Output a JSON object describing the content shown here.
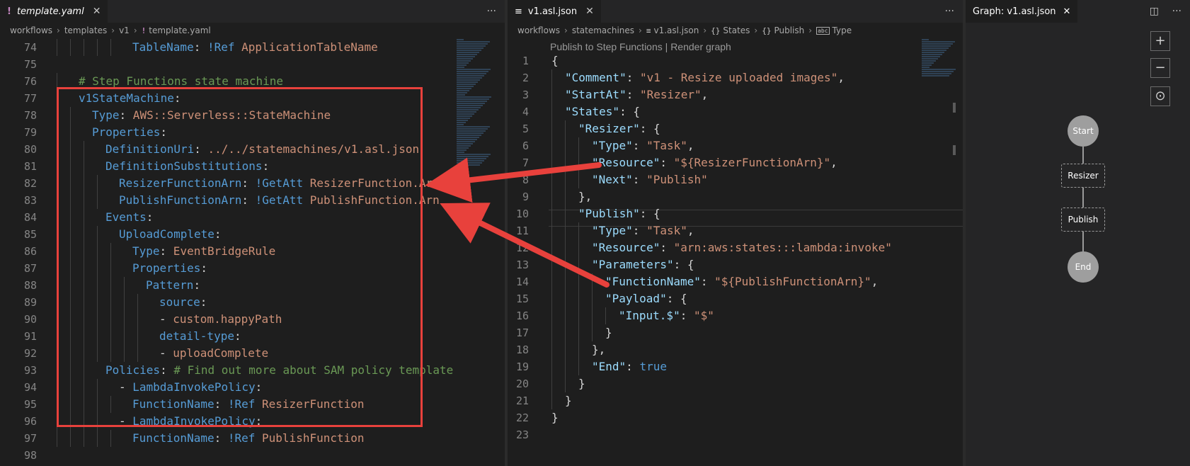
{
  "left": {
    "tab_icon": "!",
    "tab_label": "template.yaml",
    "more": "···",
    "breadcrumbs": [
      "workflows",
      "templates",
      "v1",
      "template.yaml"
    ],
    "lines": [
      {
        "n": "74",
        "t": "TableName: !Ref ApplicationTableName"
      },
      {
        "n": "75",
        "t": ""
      },
      {
        "n": "76",
        "t": "# Step Functions state machine"
      },
      {
        "n": "77",
        "t": "v1StateMachine:"
      },
      {
        "n": "78",
        "t": "Type: AWS::Serverless::StateMachine"
      },
      {
        "n": "79",
        "t": "Properties:"
      },
      {
        "n": "80",
        "t": "DefinitionUri: ../../statemachines/v1.asl.json"
      },
      {
        "n": "81",
        "t": "DefinitionSubstitutions:"
      },
      {
        "n": "82",
        "t": "ResizerFunctionArn: !GetAtt ResizerFunction.Arn"
      },
      {
        "n": "83",
        "t": "PublishFunctionArn: !GetAtt PublishFunction.Arn"
      },
      {
        "n": "84",
        "t": "Events:"
      },
      {
        "n": "85",
        "t": "UploadComplete:"
      },
      {
        "n": "86",
        "t": "Type: EventBridgeRule"
      },
      {
        "n": "87",
        "t": "Properties:"
      },
      {
        "n": "88",
        "t": "Pattern:"
      },
      {
        "n": "89",
        "t": "source:"
      },
      {
        "n": "90",
        "t": "- custom.happyPath"
      },
      {
        "n": "91",
        "t": "detail-type:"
      },
      {
        "n": "92",
        "t": "- uploadComplete"
      },
      {
        "n": "93",
        "t": "Policies: # Find out more about SAM policy template"
      },
      {
        "n": "94",
        "t": "- LambdaInvokePolicy:"
      },
      {
        "n": "95",
        "t": "FunctionName: !Ref ResizerFunction"
      },
      {
        "n": "96",
        "t": "- LambdaInvokePolicy:"
      },
      {
        "n": "97",
        "t": "FunctionName: !Ref PublishFunction"
      },
      {
        "n": "98",
        "t": ""
      }
    ]
  },
  "middle": {
    "tab_icon": "≡",
    "tab_label": "v1.asl.json",
    "more": "···",
    "breadcrumbs": [
      "workflows",
      "statemachines",
      "v1.asl.json",
      "States",
      "Publish",
      "Type"
    ],
    "codelens": {
      "publish": "Publish to Step Functions",
      "sep": " | ",
      "render": "Render graph"
    },
    "lines": [
      {
        "n": "1",
        "t": "{"
      },
      {
        "n": "2",
        "t": "\"Comment\": \"v1 - Resize uploaded images\","
      },
      {
        "n": "3",
        "t": "\"StartAt\": \"Resizer\","
      },
      {
        "n": "4",
        "t": "\"States\": {"
      },
      {
        "n": "5",
        "t": "\"Resizer\": {"
      },
      {
        "n": "6",
        "t": "\"Type\": \"Task\","
      },
      {
        "n": "7",
        "t": "\"Resource\": \"${ResizerFunctionArn}\","
      },
      {
        "n": "8",
        "t": "\"Next\": \"Publish\""
      },
      {
        "n": "9",
        "t": "},"
      },
      {
        "n": "10",
        "t": "\"Publish\": {"
      },
      {
        "n": "11",
        "t": "\"Type\": \"Task\","
      },
      {
        "n": "12",
        "t": "\"Resource\": \"arn:aws:states:::lambda:invoke\""
      },
      {
        "n": "13",
        "t": "\"Parameters\": {"
      },
      {
        "n": "14",
        "t": "\"FunctionName\": \"${PublishFunctionArn}\","
      },
      {
        "n": "15",
        "t": "\"Payload\": {"
      },
      {
        "n": "16",
        "t": "\"Input.$\": \"$\""
      },
      {
        "n": "17",
        "t": "}"
      },
      {
        "n": "18",
        "t": "},"
      },
      {
        "n": "19",
        "t": "\"End\": true"
      },
      {
        "n": "20",
        "t": "}"
      },
      {
        "n": "21",
        "t": "}"
      },
      {
        "n": "22",
        "t": "}"
      },
      {
        "n": "23",
        "t": ""
      }
    ]
  },
  "right": {
    "tab_label": "Graph: v1.asl.json",
    "close": "✕",
    "buttons": {
      "zoom_in": "+",
      "zoom_out": "−",
      "center": "⊙"
    },
    "nodes": {
      "start": "Start",
      "resizer": "Resizer",
      "publish": "Publish",
      "end": "End"
    }
  },
  "colors": {
    "annotation": "#e8413c",
    "key": "#569cd6",
    "string": "#ce9178",
    "comment": "#6a9955",
    "json_key": "#9cdcfe"
  }
}
